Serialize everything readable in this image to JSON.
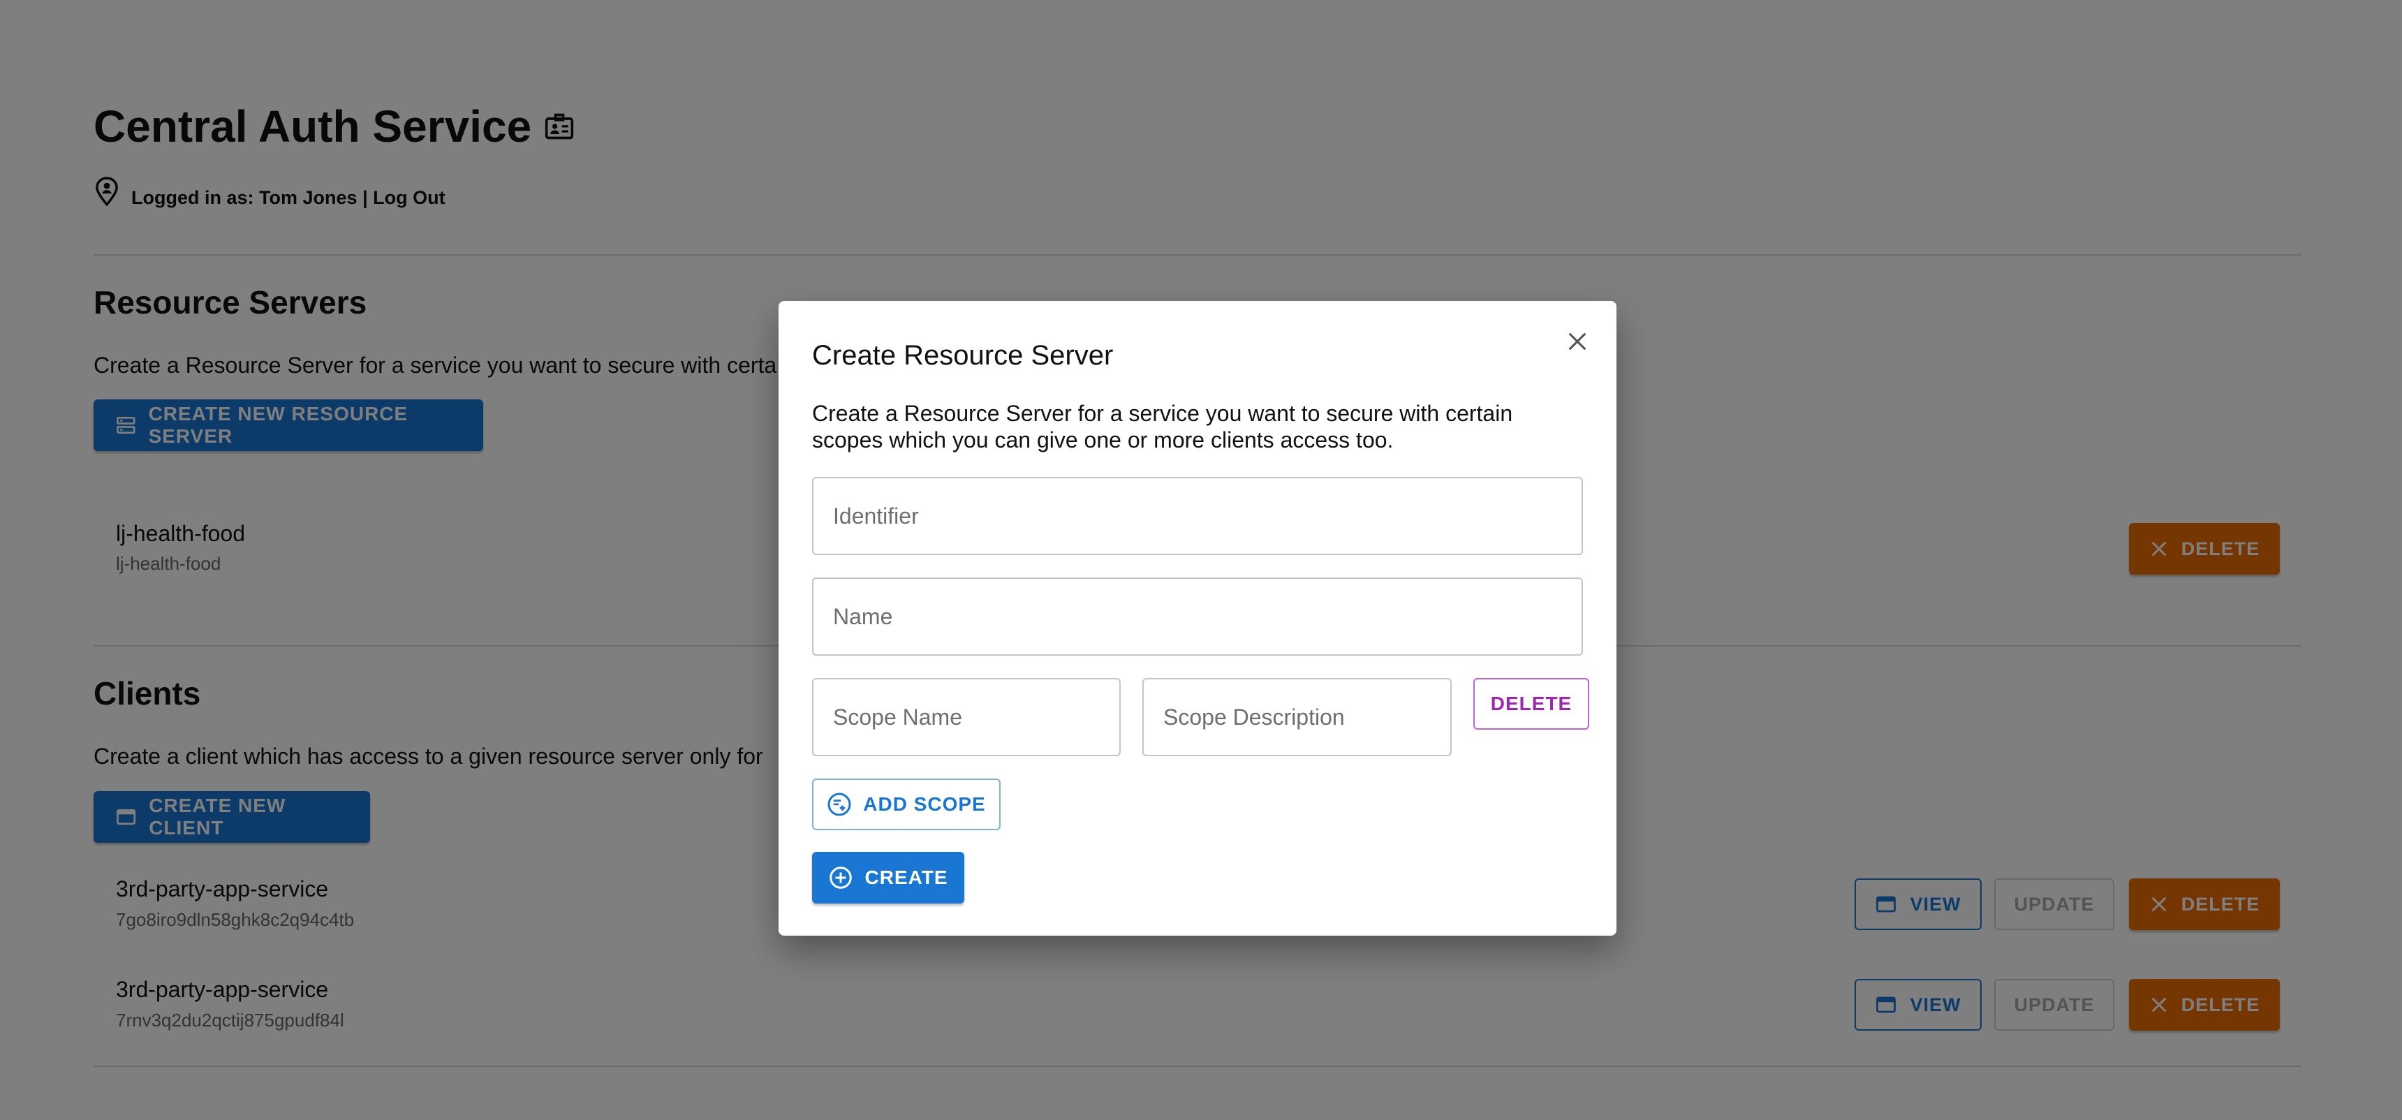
{
  "app": {
    "title": "Central Auth Service",
    "logged_in_prefix": "Logged in as:",
    "user_name": "Tom Jones",
    "separator": "|",
    "logout_label": "Log Out"
  },
  "resource_servers": {
    "title": "Resource Servers",
    "description": "Create a Resource Server for a service you want to secure with certa",
    "create_button": "CREATE NEW RESOURCE SERVER",
    "items": [
      {
        "name": "lj-health-food",
        "identifier": "lj-health-food",
        "delete_label": "DELETE"
      }
    ]
  },
  "clients": {
    "title": "Clients",
    "description": "Create a client which has access to a given resource server only for",
    "create_button": "CREATE NEW CLIENT",
    "items": [
      {
        "name": "3rd-party-app-service",
        "client_id": "7go8iro9dln58ghk8c2q94c4tb",
        "view_label": "VIEW",
        "update_label": "UPDATE",
        "delete_label": "DELETE"
      },
      {
        "name": "3rd-party-app-service",
        "client_id": "7rnv3q2du2qctij875gpudf84l",
        "view_label": "VIEW",
        "update_label": "UPDATE",
        "delete_label": "DELETE"
      }
    ]
  },
  "dialog": {
    "title": "Create Resource Server",
    "description": "Create a Resource Server for a service you want to secure with certain scopes which you can give one or more clients access too.",
    "identifier": {
      "placeholder": "Identifier",
      "value": ""
    },
    "name": {
      "placeholder": "Name",
      "value": ""
    },
    "scope_name": {
      "placeholder": "Scope Name",
      "value": ""
    },
    "scope_description": {
      "placeholder": "Scope Description",
      "value": ""
    },
    "delete_scope_label": "DELETE",
    "add_scope_label": "ADD SCOPE",
    "create_label": "CREATE"
  },
  "colors": {
    "primary": "#1976d2",
    "warning": "#ed6c02",
    "secondary": "#9c27b0",
    "overlay": "rgba(0,0,0,0.5)"
  }
}
